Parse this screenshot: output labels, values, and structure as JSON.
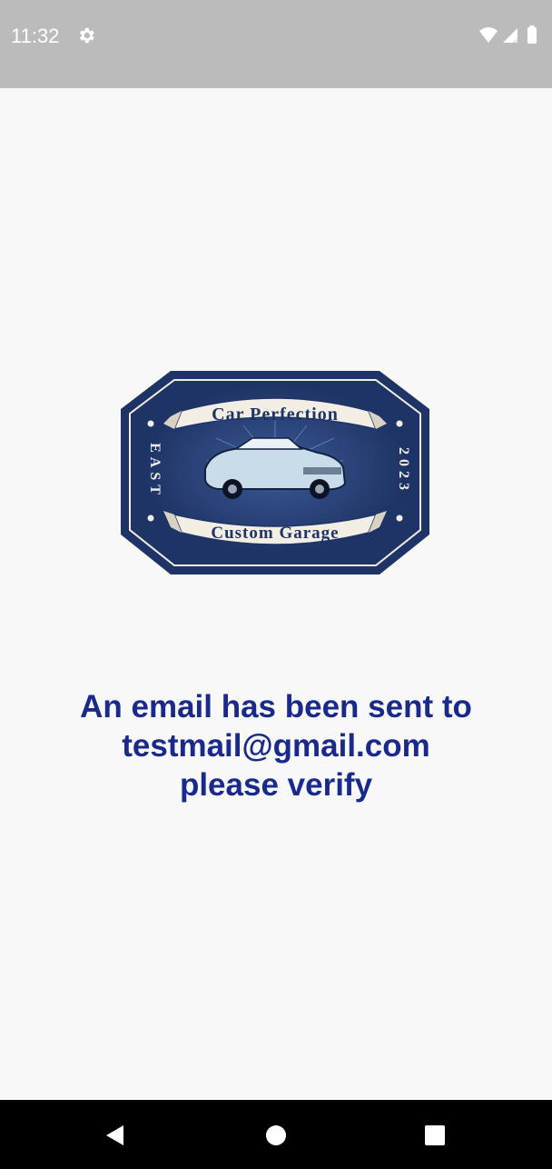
{
  "status_bar": {
    "time": "11:32",
    "icons": [
      "settings-gear-icon",
      "wifi-icon",
      "cellular-signal-icon",
      "battery-icon"
    ]
  },
  "logo": {
    "top_banner": "Car Perfection",
    "bottom_banner": "Custom Garage",
    "left_text": "EAST",
    "right_text": "2023",
    "colors": {
      "badge": "#1f3466",
      "banner": "#f2eee4",
      "car": "#c9dcea"
    }
  },
  "message": {
    "line1": "An email has been sent to",
    "line2": "testmail@gmail.com",
    "line3": "please verify",
    "color": "#1a2a8c"
  },
  "nav_bar": {
    "icons": [
      "back-icon",
      "home-icon",
      "recents-icon"
    ]
  }
}
